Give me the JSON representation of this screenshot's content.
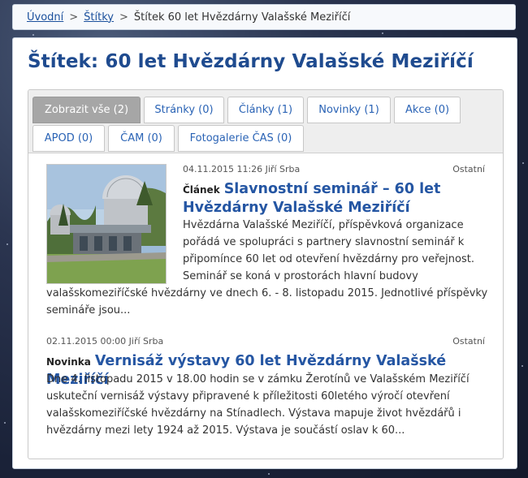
{
  "breadcrumb": {
    "home": "Úvodní",
    "sep": ">",
    "tags": "Štítky",
    "current": "Štítek 60 let Hvězdárny Valašské Meziříčí"
  },
  "page_title": "Štítek: 60 let Hvězdárny Valašské Meziříčí",
  "tabs": [
    {
      "label": "Zobrazit vše (2)",
      "active": true
    },
    {
      "label": "Stránky (0)"
    },
    {
      "label": "Články (1)"
    },
    {
      "label": "Novinky (1)"
    },
    {
      "label": "Akce (0)"
    },
    {
      "label": "APOD (0)"
    },
    {
      "label": "ČAM (0)"
    },
    {
      "label": "Fotogalerie ČAS (0)"
    }
  ],
  "items": [
    {
      "meta": "04.11.2015 11:26 Jiří Srba",
      "category": "Ostatní",
      "type": "Článek",
      "title_lines": [
        "Slavnostní seminář – 60 let",
        "Hvězdárny Valašské Meziříčí"
      ],
      "excerpt_lines": [
        "Hvězdárna Valašské Meziříčí, příspěvková organizace",
        "pořádá ve spolupráci s partnery slavnostní seminář k",
        "připomínce 60 let od otevření hvězdárny pro veřejnost.",
        "Seminář se koná v prostorách hlavní budovy",
        "valašskomeziříčské hvězdárny ve dnech 6. - 8. listopadu 2015. Jednotlivé příspěvky",
        "semináře jsou..."
      ],
      "image_alt": "observatory-domes-photo"
    },
    {
      "meta": "02.11.2015 00:00 Jiří Srba",
      "category": "Ostatní",
      "type": "Novinka",
      "title": "Vernisáž výstavy 60 let Hvězdárny Valašské Meziříčí",
      "excerpt_lines": [
        "Dne 4. listopadu 2015 v 18.00 hodin se v zámku Žerotínů ve Valašském Meziříčí",
        "uskuteční vernisáž výstavy připravené k příležitosti 60letého výročí otevření",
        "valašskomeziříčské hvězdárny na Stínadlech. Výstava mapuje život hvězdářů i",
        "hvězdárny mezi lety 1924 až 2015. Výstava je součástí oslav k 60..."
      ]
    }
  ],
  "colors": {
    "accent": "#1f4b8f",
    "link": "#2a63b5",
    "active_tab": "#a6a6a6"
  }
}
